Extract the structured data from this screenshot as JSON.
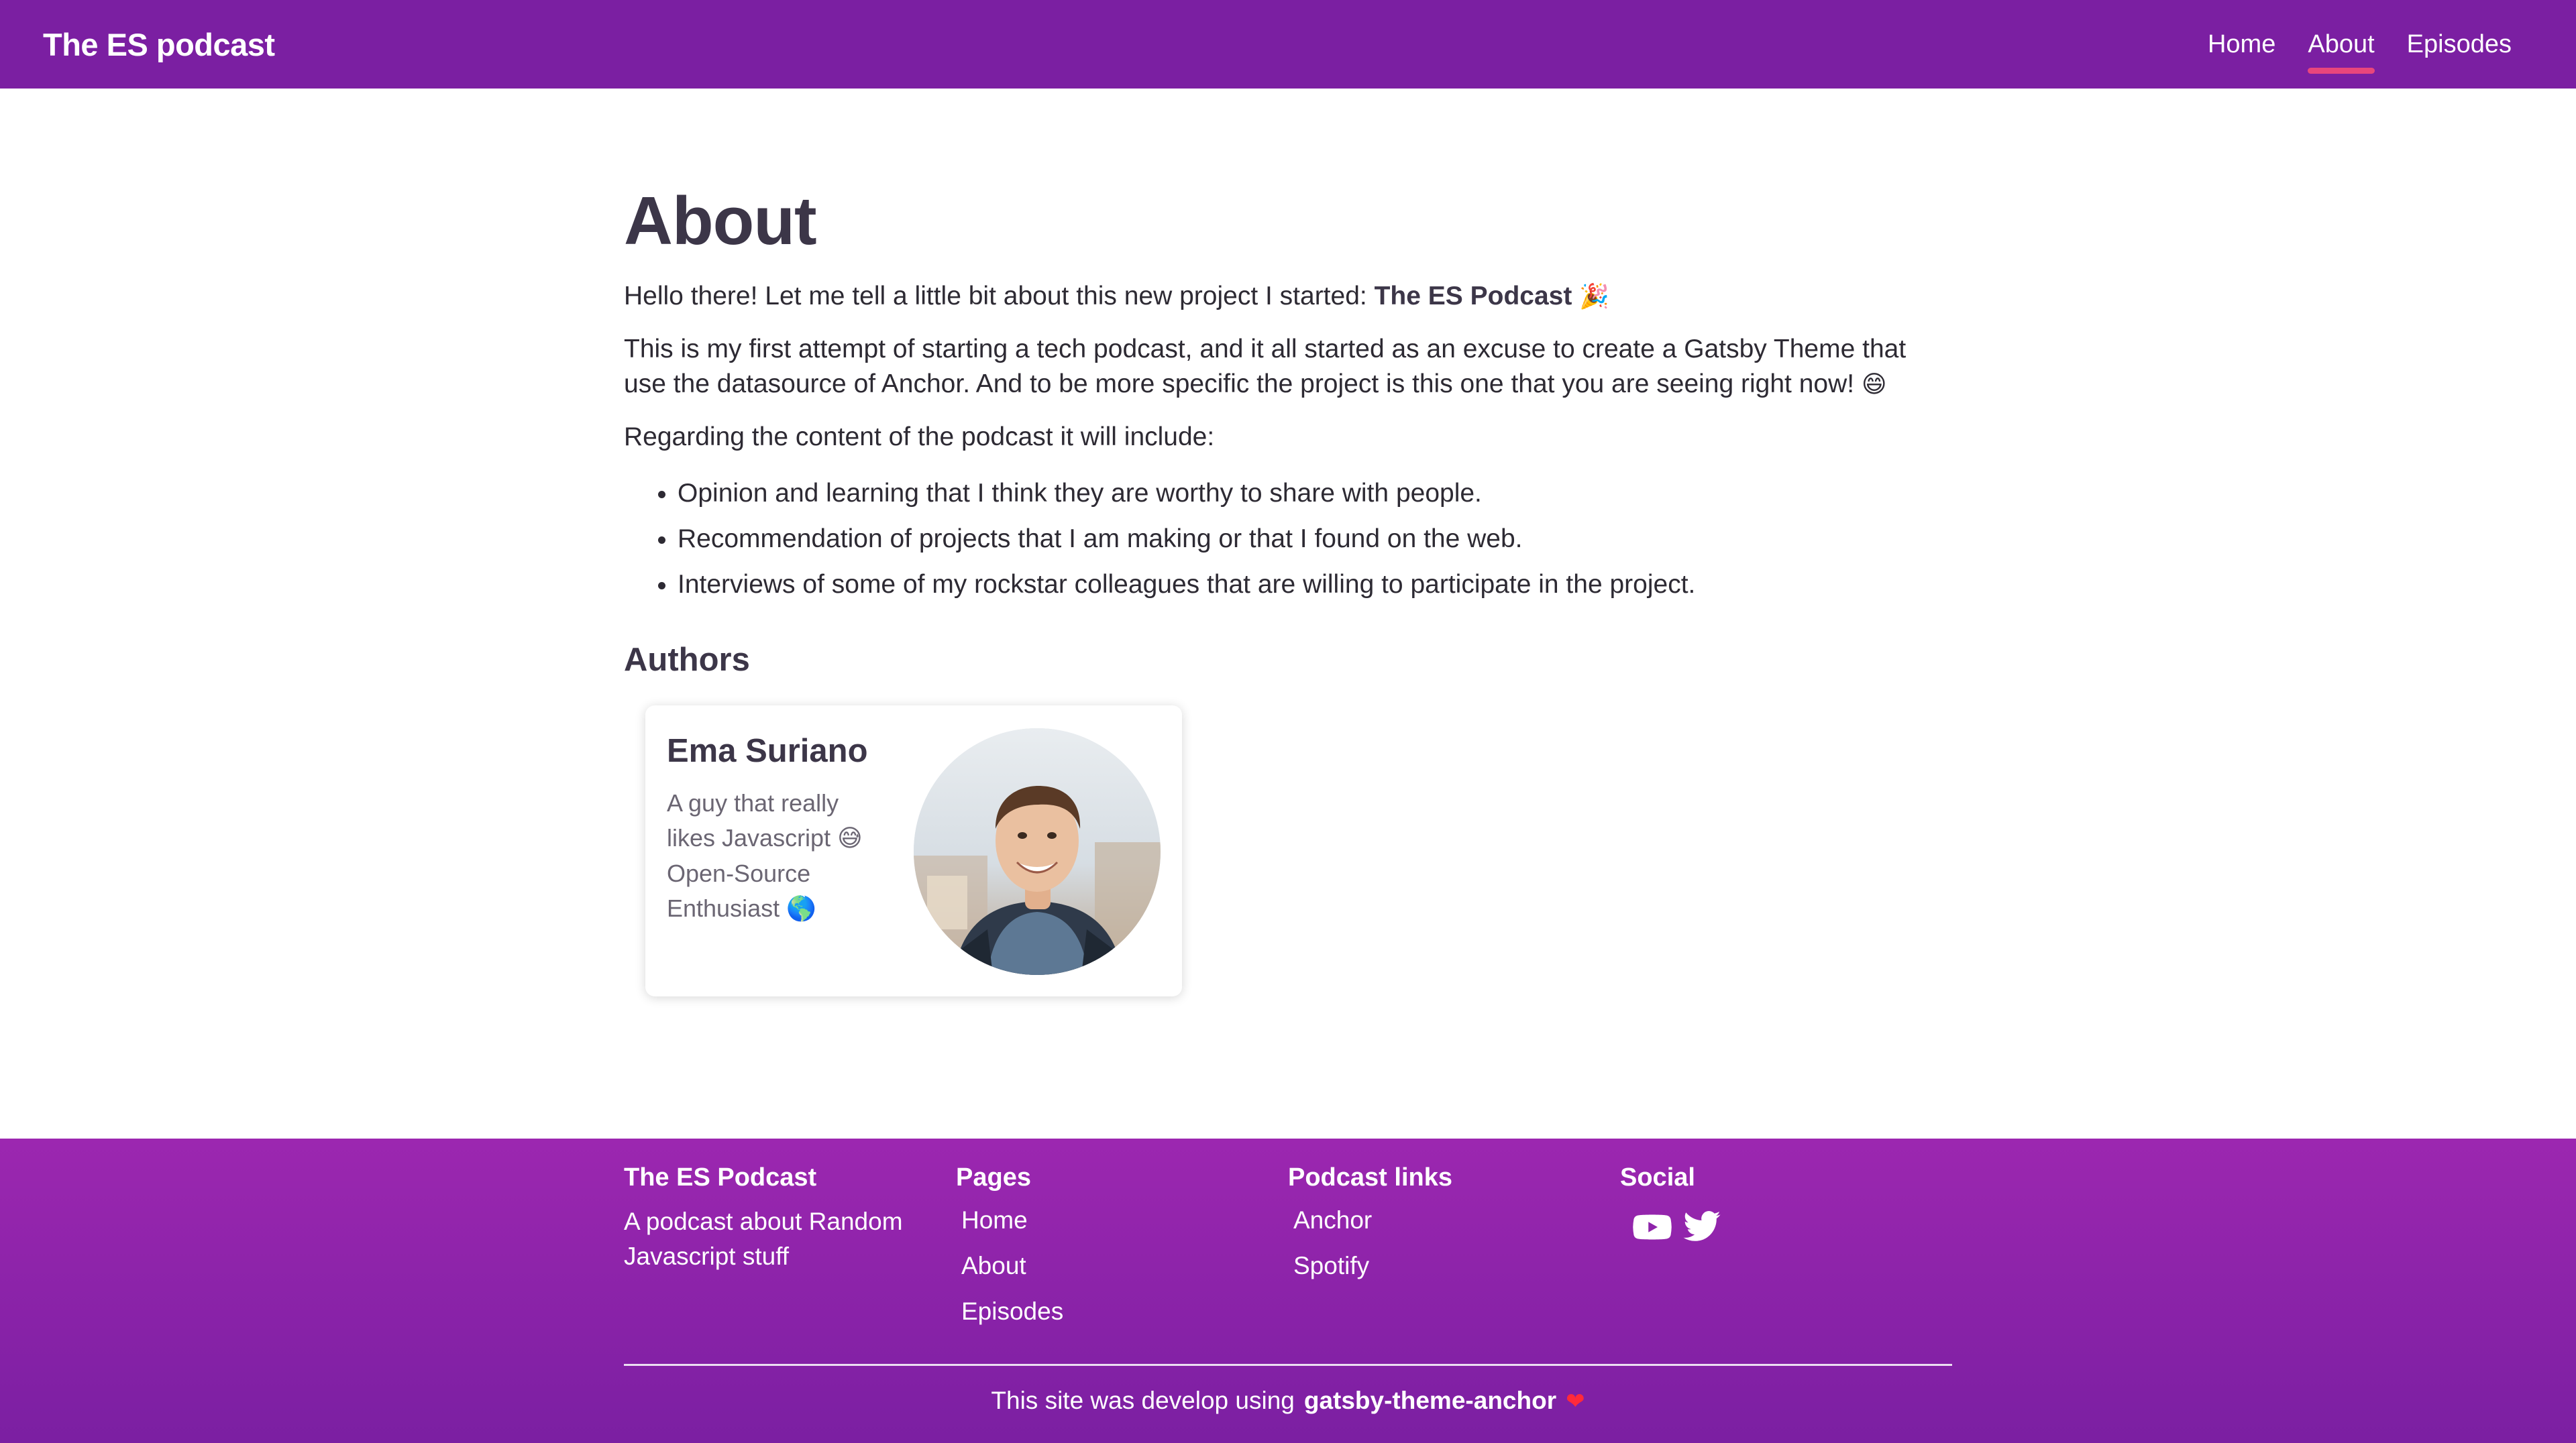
{
  "header": {
    "brand": "The ES podcast",
    "nav": [
      {
        "label": "Home"
      },
      {
        "label": "About",
        "active": true
      },
      {
        "label": "Episodes"
      }
    ]
  },
  "main": {
    "title": "About",
    "intro_text": "Hello there! Let me tell a little bit about this new project I started: ",
    "intro_bold": "The ES Podcast",
    "intro_emoji": "🎉",
    "paragraph2": "This is my first attempt of starting a tech podcast, and it all started as an excuse to create a Gatsby Theme that use the datasource of Anchor. And to be more specific the project is this one that you are seeing right now! ",
    "paragraph2_emoji": "😄",
    "paragraph3": "Regarding the content of the podcast it will include:",
    "list": [
      "Opinion and learning that I think they are worthy to share with people.",
      "Recommendation of projects that I am making or that I found on the web.",
      "Interviews of some of my rockstar colleagues that are willing to participate in the project."
    ],
    "authors_heading": "Authors",
    "author": {
      "name": "Ema Suriano",
      "bio_line1": "A guy that really",
      "bio_line2": "likes Javascript ",
      "bio_emoji1": "😅",
      "bio_line3": "Open-Source",
      "bio_line4": "Enthusiast ",
      "bio_emoji2": "🌎"
    }
  },
  "footer": {
    "col1": {
      "title": "The ES Podcast",
      "text": "A podcast about Random Javascript stuff"
    },
    "col2": {
      "title": "Pages",
      "links": [
        "Home",
        "About",
        "Episodes"
      ]
    },
    "col3": {
      "title": "Podcast links",
      "links": [
        "Anchor",
        "Spotify"
      ]
    },
    "col4": {
      "title": "Social",
      "icons": [
        "youtube-icon",
        "twitter-icon"
      ]
    },
    "credit_prefix": "This site was develop using",
    "credit_bold": "gatsby-theme-anchor",
    "credit_heart": "❤"
  },
  "colors": {
    "header_bg": "#7b1fa2",
    "active_underline": "#e8467c",
    "footer_gradient_top": "#9c27b0",
    "footer_gradient_bottom": "#7b1fa2",
    "text_dark": "#3c3648"
  }
}
